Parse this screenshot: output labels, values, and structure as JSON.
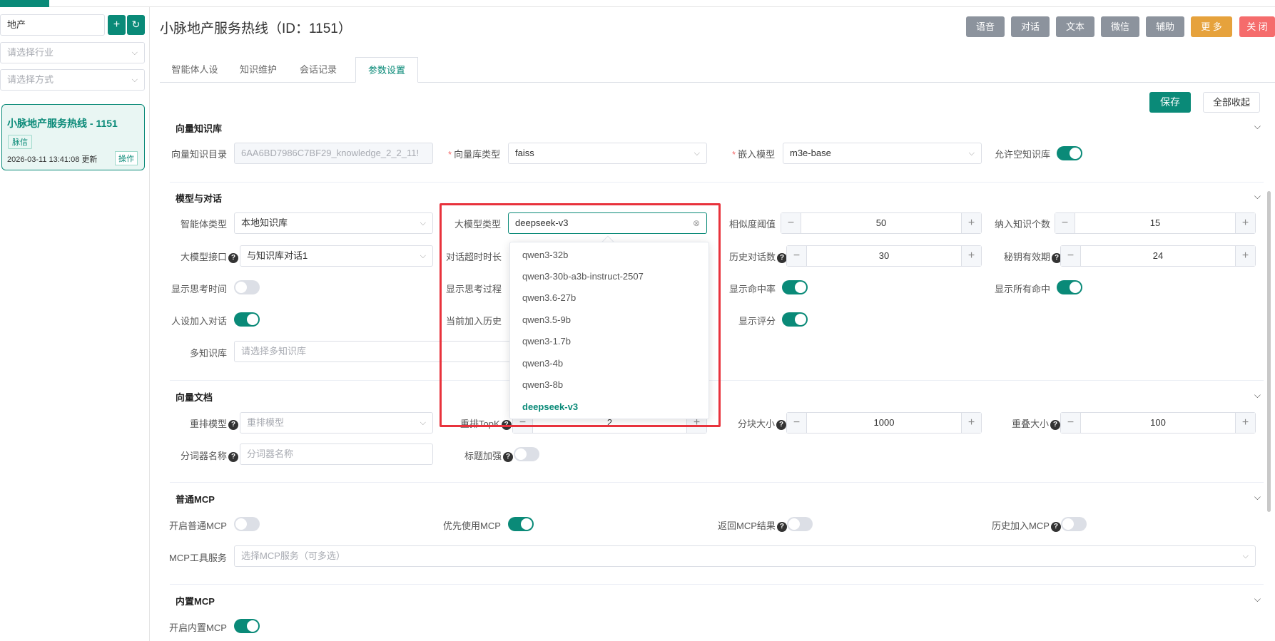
{
  "sidebar": {
    "search_value": "地产",
    "add_icon": "plus-icon",
    "refresh_icon": "refresh-icon",
    "industry_placeholder": "请选择行业",
    "method_placeholder": "请选择方式",
    "card": {
      "title": "小脉地产服务热线 - 1151",
      "tag": "脉信",
      "time": "2026-03-11 13:41:08 更新",
      "op": "操作"
    }
  },
  "header": {
    "title": "小脉地产服务热线（ID：1151）",
    "buttons": [
      {
        "label": "语音",
        "color": "#8c939d"
      },
      {
        "label": "对话",
        "color": "#8c939d"
      },
      {
        "label": "文本",
        "color": "#8c939d"
      },
      {
        "label": "微信",
        "color": "#8c939d"
      },
      {
        "label": "辅助",
        "color": "#8c939d"
      },
      {
        "label": "更 多",
        "color": "#e6a23c"
      },
      {
        "label": "关 闭",
        "color": "#f56c6c"
      }
    ]
  },
  "tabs": [
    "智能体人设",
    "知识维护",
    "会话记录",
    "参数设置"
  ],
  "active_tab": "参数设置",
  "actions": {
    "save": "保存",
    "collapse_all": "全部收起"
  },
  "vector_kb": {
    "title": "向量知识库",
    "dir_label": "向量知识目录",
    "dir_value": "6AA6BD7986C7BF29_knowledge_2_2_11!",
    "type_label": "向量库类型",
    "type_value": "faiss",
    "embed_label": "嵌入模型",
    "embed_value": "m3e-base",
    "allow_empty_label": "允许空知识库",
    "allow_empty": true
  },
  "model": {
    "title": "模型与对话",
    "agent_type_label": "智能体类型",
    "agent_type_value": "本地知识库",
    "llm_type_label": "大模型类型",
    "llm_type_value": "deepseek-v3",
    "similarity_label": "相似度阈值",
    "similarity_value": "50",
    "kb_count_label": "纳入知识个数",
    "kb_count_value": "15",
    "llm_api_label": "大模型接口",
    "llm_api_value": "与知识库对话1",
    "timeout_label": "对话超时时长",
    "history_label": "历史对话数",
    "history_value": "30",
    "secret_label": "秘钥有效期",
    "secret_value": "24",
    "show_think_time_label": "显示思考时间",
    "show_think_time": false,
    "show_think_label": "显示思考过程",
    "show_hit_label": "显示命中率",
    "show_hit": true,
    "show_all_hit_label": "显示所有命中",
    "show_all_hit": true,
    "persona_label": "人设加入对话",
    "persona": true,
    "add_history_label": "当前加入历史",
    "show_score_label": "显示评分",
    "show_score": true,
    "multi_kb_label": "多知识库",
    "multi_kb_placeholder": "请选择多知识库"
  },
  "llm_options": [
    "qwen3-32b",
    "qwen3-30b-a3b-instruct-2507",
    "qwen3.6-27b",
    "qwen3.5-9b",
    "qwen3-1.7b",
    "qwen3-4b",
    "qwen3-8b",
    "deepseek-v3"
  ],
  "llm_selected": "deepseek-v3",
  "vector_doc": {
    "title": "向量文档",
    "rerank_label": "重排模型",
    "rerank_placeholder": "重排模型",
    "rerank_topk_label": "重排TopK",
    "rerank_topk_value": "2",
    "chunk_label": "分块大小",
    "chunk_value": "1000",
    "overlap_label": "重叠大小",
    "overlap_value": "100",
    "tokenizer_label": "分词器名称",
    "tokenizer_placeholder": "分词器名称",
    "title_boost_label": "标题加强",
    "title_boost": false
  },
  "mcp": {
    "title": "普通MCP",
    "enable_label": "开启普通MCP",
    "enable": false,
    "prefer_label": "优先使用MCP",
    "prefer": true,
    "return_label": "返回MCP结果",
    "return": false,
    "history_label": "历史加入MCP",
    "history": false,
    "tools_label": "MCP工具服务",
    "tools_placeholder": "选择MCP服务（可多选）"
  },
  "builtin_mcp": {
    "title": "内置MCP",
    "enable_label": "开启内置MCP",
    "enable": true
  },
  "colors": {
    "primary": "#0a8a78",
    "danger": "#e8323c",
    "warning": "#e6a23c"
  }
}
